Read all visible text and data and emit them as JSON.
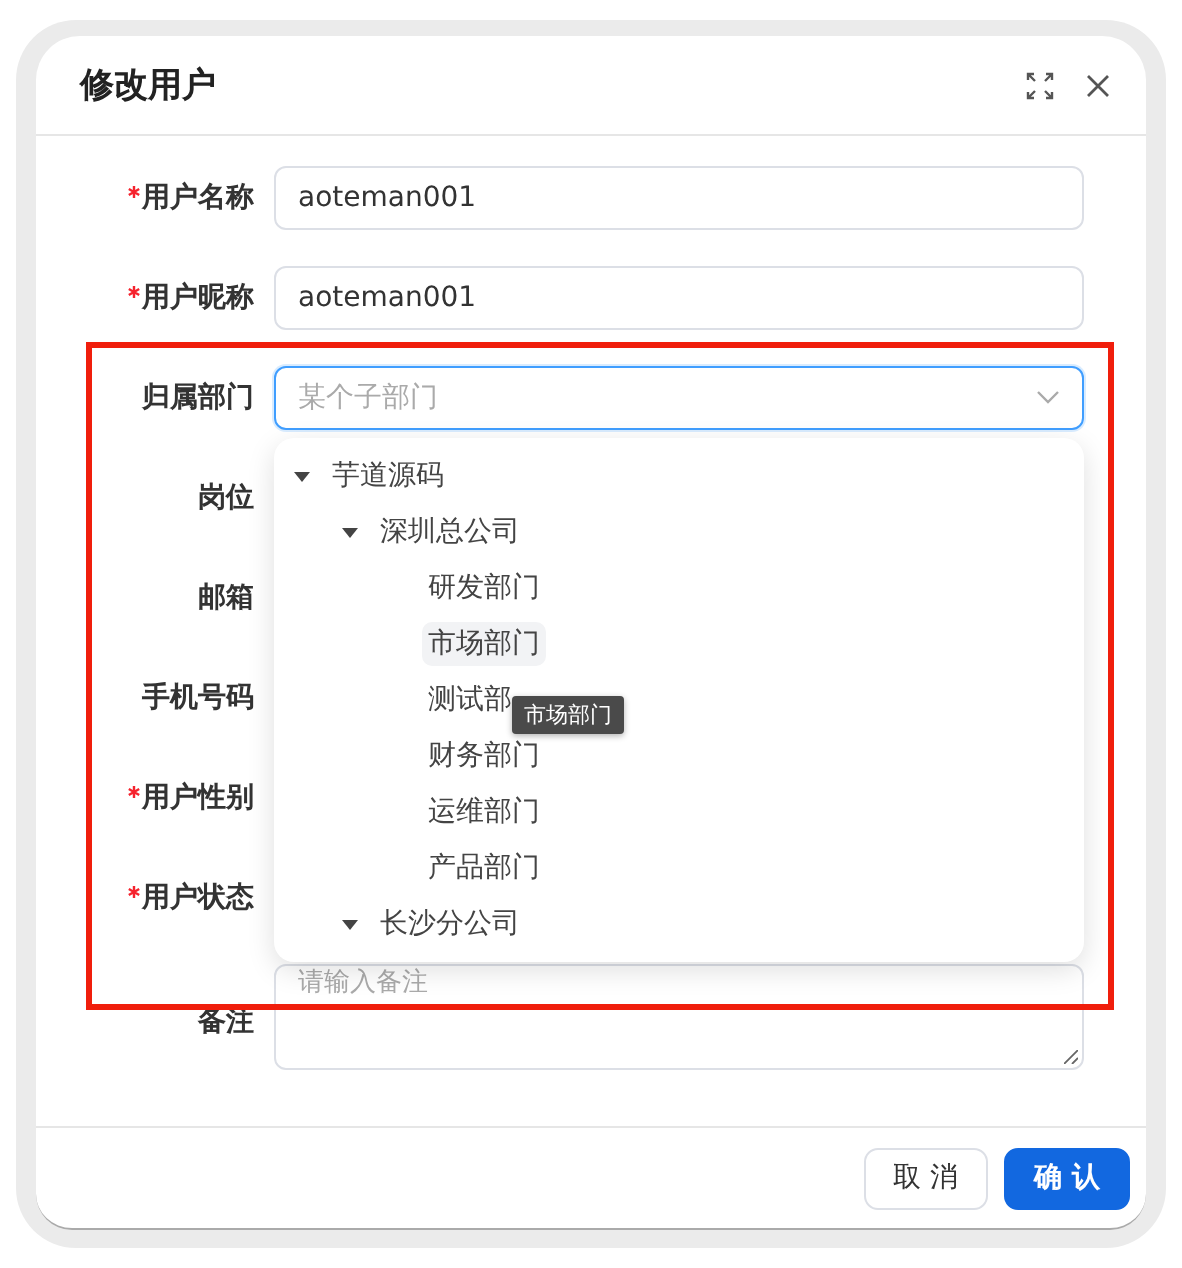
{
  "dialog": {
    "title": "修改用户",
    "fields": [
      {
        "label": "用户名称",
        "required": true,
        "kind": "text",
        "value": "aoteman001"
      },
      {
        "label": "用户昵称",
        "required": true,
        "kind": "text",
        "value": "aoteman001"
      },
      {
        "label": "归属部门",
        "required": false,
        "kind": "tree-select",
        "placeholder": "某个子部门",
        "focused": true
      },
      {
        "label": "岗位",
        "required": false,
        "kind": "label-only"
      },
      {
        "label": "邮箱",
        "required": false,
        "kind": "label-only"
      },
      {
        "label": "手机号码",
        "required": false,
        "kind": "label-only"
      },
      {
        "label": "用户性别",
        "required": true,
        "kind": "label-only"
      },
      {
        "label": "用户状态",
        "required": true,
        "kind": "label-only"
      },
      {
        "label": "备注",
        "required": false,
        "kind": "textarea",
        "placeholder": "请输入备注"
      }
    ],
    "dropdown": {
      "tree": [
        {
          "label": "芋道源码",
          "expanded": true,
          "hovered": false,
          "children": [
            {
              "label": "深圳总公司",
              "expanded": true,
              "hovered": false,
              "children": [
                {
                  "label": "研发部门",
                  "hovered": false
                },
                {
                  "label": "市场部门",
                  "hovered": true
                },
                {
                  "label": "测试部",
                  "hovered": false
                },
                {
                  "label": "财务部门",
                  "hovered": false
                },
                {
                  "label": "运维部门",
                  "hovered": false
                },
                {
                  "label": "产品部门",
                  "hovered": false
                }
              ]
            },
            {
              "label": "长沙分公司",
              "expanded": true,
              "hovered": false
            }
          ]
        }
      ],
      "tooltip": "市场部门"
    },
    "buttons": [
      {
        "label": "取 消",
        "kind": "default"
      },
      {
        "label": "确 认",
        "kind": "primary"
      }
    ]
  }
}
